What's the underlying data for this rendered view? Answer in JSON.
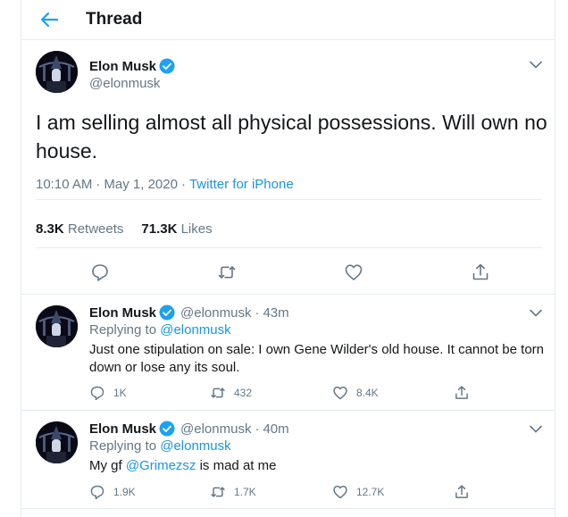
{
  "header": {
    "title": "Thread",
    "back_icon": "arrow-left-icon"
  },
  "colors": {
    "accent": "#1da1f2",
    "link": "#1b95e0",
    "secondary_text": "#657786",
    "border": "#e6ecf0"
  },
  "main_tweet": {
    "author": {
      "name": "Elon Musk",
      "handle": "@elonmusk",
      "verified": true
    },
    "text": "I am selling almost all physical possessions. Will own no house.",
    "time": "10:10 AM",
    "date": "May 1, 2020",
    "app": "Twitter for iPhone",
    "retweets_count": "8.3K",
    "retweets_label": "Retweets",
    "likes_count": "71.3K",
    "likes_label": "Likes",
    "actions": [
      "reply-icon",
      "retweet-icon",
      "like-icon",
      "share-icon"
    ]
  },
  "replies": [
    {
      "author": {
        "name": "Elon Musk",
        "handle": "@elonmusk",
        "verified": true
      },
      "time_ago": "43m",
      "replying_label": "Replying to",
      "replying_to": "@elonmusk",
      "text": "Just one stipulation on sale: I own Gene Wilder's old house. It cannot be torn down or lose any its soul.",
      "reply_count": "1K",
      "retweet_count": "432",
      "like_count": "8.4K"
    },
    {
      "author": {
        "name": "Elon Musk",
        "handle": "@elonmusk",
        "verified": true
      },
      "time_ago": "40m",
      "replying_label": "Replying to",
      "replying_to": "@elonmusk",
      "text_prefix": "My gf",
      "text_mention": "@Grimezsz",
      "text_suffix": "is mad at me",
      "reply_count": "1.9K",
      "retweet_count": "1.7K",
      "like_count": "12.7K"
    }
  ]
}
